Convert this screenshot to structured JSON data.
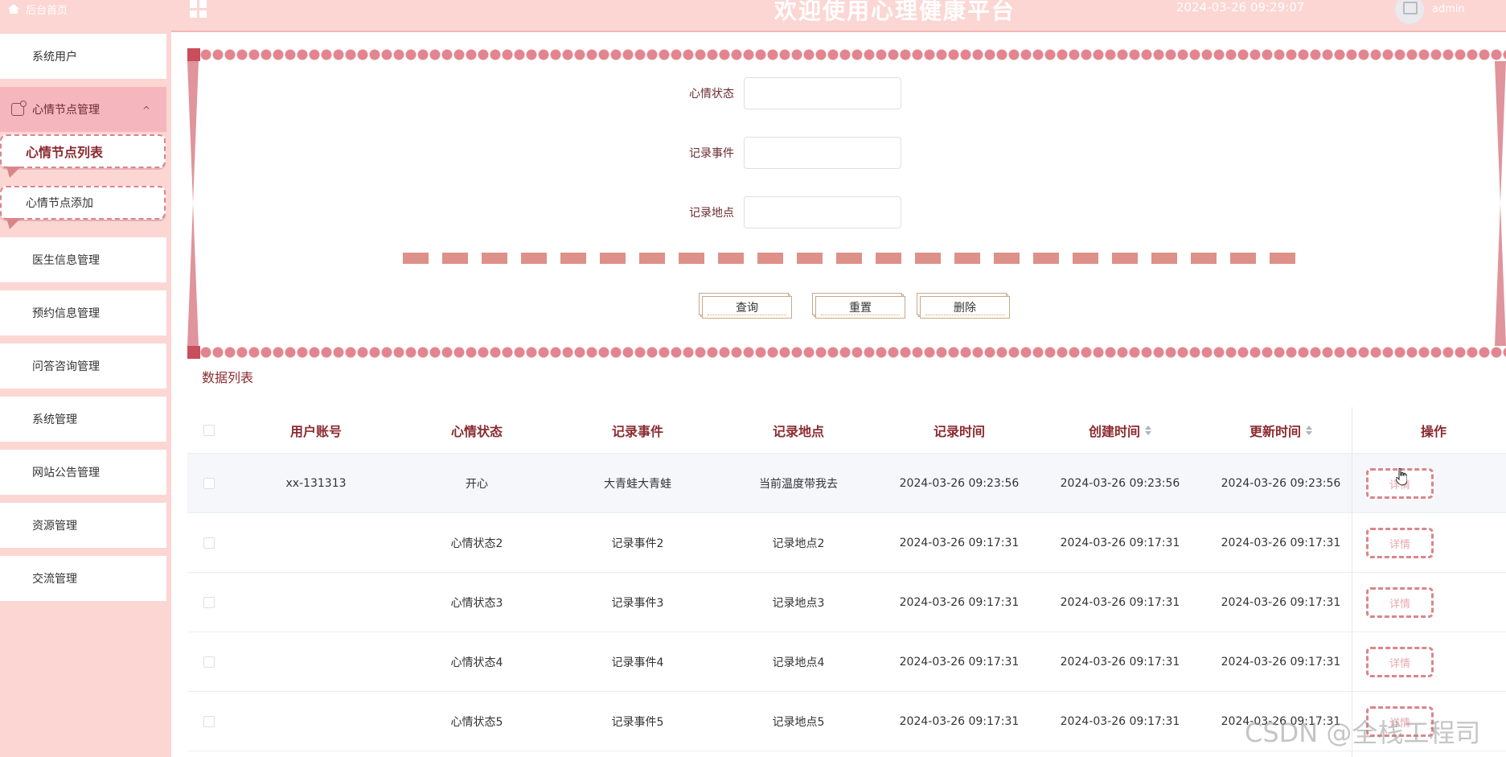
{
  "sidebar": {
    "home_label": "后台首页",
    "items": [
      {
        "label": "系统用户"
      },
      {
        "label": "心情节点管理"
      },
      {
        "label": "医生信息管理"
      },
      {
        "label": "预约信息管理"
      },
      {
        "label": "问答咨询管理"
      },
      {
        "label": "系统管理"
      },
      {
        "label": "网站公告管理"
      },
      {
        "label": "资源管理"
      },
      {
        "label": "交流管理"
      }
    ],
    "sub_items": [
      {
        "label": "心情节点列表"
      },
      {
        "label": "心情节点添加"
      }
    ],
    "expanded_chevron": "^"
  },
  "header": {
    "title": "欢迎使用心理健康平台",
    "datetime": "2024-03-26 09:29:07",
    "user": "admin"
  },
  "search": {
    "fields": [
      {
        "label": "心情状态",
        "value": ""
      },
      {
        "label": "记录事件",
        "value": ""
      },
      {
        "label": "记录地点",
        "value": ""
      }
    ],
    "buttons": {
      "query": "查询",
      "reset": "重置",
      "delete": "删除"
    }
  },
  "list": {
    "title": "数据列表",
    "columns": [
      "用户账号",
      "心情状态",
      "记录事件",
      "记录地点",
      "记录时间",
      "创建时间",
      "更新时间",
      "操作"
    ],
    "rows": [
      {
        "account": "xx-131313",
        "mood": "开心",
        "event": "大青蛙大青蛙",
        "place": "当前温度带我去",
        "record_time": "2024-03-26 09:23:56",
        "create_time": "2024-03-26 09:23:56",
        "update_time": "2024-03-26 09:23:56",
        "action": "详情"
      },
      {
        "account": "",
        "mood": "心情状态2",
        "event": "记录事件2",
        "place": "记录地点2",
        "record_time": "2024-03-26 09:17:31",
        "create_time": "2024-03-26 09:17:31",
        "update_time": "2024-03-26 09:17:31",
        "action": "详情"
      },
      {
        "account": "",
        "mood": "心情状态3",
        "event": "记录事件3",
        "place": "记录地点3",
        "record_time": "2024-03-26 09:17:31",
        "create_time": "2024-03-26 09:17:31",
        "update_time": "2024-03-26 09:17:31",
        "action": "详情"
      },
      {
        "account": "",
        "mood": "心情状态4",
        "event": "记录事件4",
        "place": "记录地点4",
        "record_time": "2024-03-26 09:17:31",
        "create_time": "2024-03-26 09:17:31",
        "update_time": "2024-03-26 09:17:31",
        "action": "详情"
      },
      {
        "account": "",
        "mood": "心情状态5",
        "event": "记录事件5",
        "place": "记录地点5",
        "record_time": "2024-03-26 09:17:31",
        "create_time": "2024-03-26 09:17:31",
        "update_time": "2024-03-26 09:17:31",
        "action": "详情"
      }
    ]
  },
  "watermark": "CSDN @全栈工程司",
  "colors": {
    "theme_pink": "#fcd6d3",
    "active_pink": "#f5b7bd",
    "accent_dark": "#8a2b30",
    "dash": "#d9868b"
  },
  "icons": {
    "home": "home-icon",
    "menu": "grid-menu-icon",
    "mood_node": "node-manage-icon",
    "avatar": "avatar-image-icon",
    "sort": "sort-caret-icon",
    "cursor": "hand-cursor-icon"
  }
}
